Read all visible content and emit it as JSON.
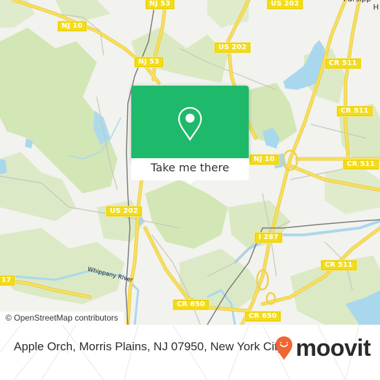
{
  "map": {
    "colors": {
      "background": "#f2f2ee",
      "forest": "#cfe3ad",
      "forest_light": "#dcebc4",
      "water": "#a9d8ee",
      "road_major": "#f5dc5a",
      "road_major_edge": "#e6c43a",
      "road_minor": "#c9c6c0",
      "rail": "#777777"
    },
    "shields": [
      {
        "label": "NJ 53",
        "id": "nj53-top"
      },
      {
        "label": "US 202",
        "id": "us202-top"
      },
      {
        "label": "NJ 10",
        "id": "nj10-west"
      },
      {
        "label": "NJ 53",
        "id": "nj53-mid"
      },
      {
        "label": "US 202",
        "id": "us202-north"
      },
      {
        "label": "CR 511",
        "id": "cr511-north"
      },
      {
        "label": "CR 511",
        "id": "cr511-east1"
      },
      {
        "label": "NJ 10",
        "id": "nj10-east"
      },
      {
        "label": "CR 511",
        "id": "cr511-east2"
      },
      {
        "label": "US 202",
        "id": "us202-south"
      },
      {
        "label": "I 287",
        "id": "i287"
      },
      {
        "label": "CR 511",
        "id": "cr511-south"
      },
      {
        "label": "17",
        "id": "route17"
      },
      {
        "label": "CR 650",
        "id": "cr650-west"
      },
      {
        "label": "CR 650",
        "id": "cr650-east"
      }
    ],
    "place_labels": {
      "parsippany": "Parsipp",
      "parsippany_line2": "H"
    },
    "river_label": "Whippany River",
    "attribution": "© OpenStreetMap contributors"
  },
  "popup": {
    "icon": "map-pin-icon",
    "accent_color": "#1fb96b",
    "button_label": "Take me there"
  },
  "footer": {
    "address": "Apple Orch, Morris Plains, NJ 07950, New York City",
    "brand": {
      "name": "moovit",
      "pin_color": "#f26430"
    }
  }
}
